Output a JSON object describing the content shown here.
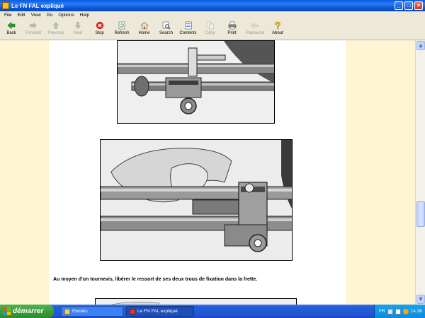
{
  "window": {
    "title": "Le FN FAL expliqué"
  },
  "menu": [
    "File",
    "Edit",
    "View",
    "Go",
    "Options",
    "Help"
  ],
  "toolbar": [
    {
      "label": "Back",
      "icon": "back-arrow-icon",
      "enabled": true
    },
    {
      "label": "Forward",
      "icon": "forward-arrow-icon",
      "enabled": false
    },
    {
      "label": "Previous",
      "icon": "up-arrow-icon",
      "enabled": false
    },
    {
      "label": "Next",
      "icon": "down-arrow-icon",
      "enabled": false
    },
    {
      "label": "Stop",
      "icon": "stop-icon",
      "enabled": true
    },
    {
      "label": "Refresh",
      "icon": "refresh-icon",
      "enabled": true
    },
    {
      "label": "Home",
      "icon": "home-icon",
      "enabled": true
    },
    {
      "label": "Search",
      "icon": "search-icon",
      "enabled": true
    },
    {
      "label": "Contents",
      "icon": "contents-icon",
      "enabled": true
    },
    {
      "label": "Copy",
      "icon": "copy-icon",
      "enabled": false
    },
    {
      "label": "Print",
      "icon": "print-icon",
      "enabled": true
    },
    {
      "label": "Password",
      "icon": "password-icon",
      "enabled": false
    },
    {
      "label": "About",
      "icon": "about-icon",
      "enabled": true
    }
  ],
  "content": {
    "caption": "Au moyen d'un tournevis, libérer le ressort de ses deux trous de fixation dans la frette."
  },
  "taskbar": {
    "start_label": "démarrer",
    "tasks": [
      {
        "label": "Ebooks",
        "active": false
      },
      {
        "label": "Le FN FAL expliqué",
        "active": true
      }
    ],
    "language": "FR",
    "clock": "14:36"
  },
  "colors": {
    "page_background": "#fdf5d3",
    "titlebar_blue": "#0a5ce8",
    "taskbar_blue": "#245edb",
    "start_green": "#3a9a37"
  }
}
